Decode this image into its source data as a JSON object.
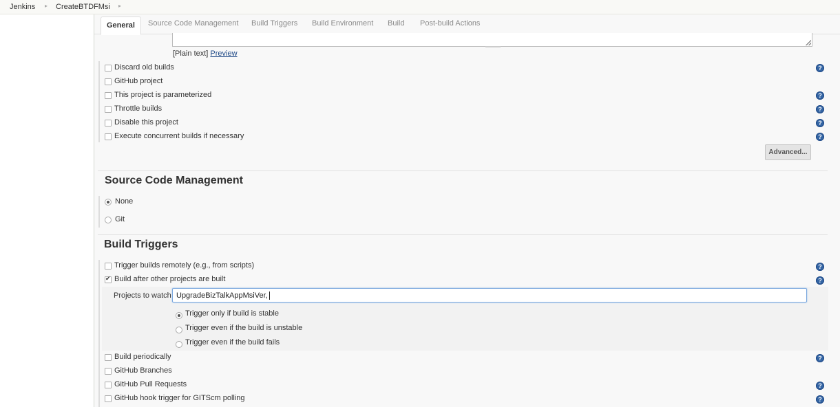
{
  "breadcrumb": {
    "items": [
      "Jenkins",
      "CreateBTDFMsi"
    ]
  },
  "tabs": [
    "General",
    "Source Code Management",
    "Build Triggers",
    "Build Environment",
    "Build",
    "Post-build Actions"
  ],
  "description": {
    "plain_text_label": "[Plain text]",
    "preview_link": "Preview"
  },
  "general": {
    "options": [
      {
        "label": "Discard old builds",
        "checked": false
      },
      {
        "label": "GitHub project",
        "checked": false
      },
      {
        "label": "This project is parameterized",
        "checked": false
      },
      {
        "label": "Throttle builds",
        "checked": false
      },
      {
        "label": "Disable this project",
        "checked": false
      },
      {
        "label": "Execute concurrent builds if necessary",
        "checked": false
      }
    ],
    "advanced_button": "Advanced..."
  },
  "scm": {
    "title": "Source Code Management",
    "options": [
      {
        "label": "None",
        "selected": true
      },
      {
        "label": "Git",
        "selected": false
      }
    ]
  },
  "triggers": {
    "title": "Build Triggers",
    "trigger_remote": "Trigger builds remotely (e.g., from scripts)",
    "build_after": "Build after other projects are built",
    "projects_to_watch_label": "Projects to watch",
    "projects_to_watch_value": "UpgradeBizTalkAppMsiVer,",
    "trigger_modes": [
      {
        "label": "Trigger only if build is stable",
        "selected": true
      },
      {
        "label": "Trigger even if the build is unstable",
        "selected": false
      },
      {
        "label": "Trigger even if the build fails",
        "selected": false
      }
    ],
    "more": [
      {
        "label": "Build periodically"
      },
      {
        "label": "GitHub Branches"
      },
      {
        "label": "GitHub Pull Requests"
      },
      {
        "label": "GitHub hook trigger for GITScm polling"
      }
    ]
  },
  "help_icon": "?",
  "icons": [
    "chevron-right-icon",
    "help-icon",
    "resize-grip-icon"
  ]
}
